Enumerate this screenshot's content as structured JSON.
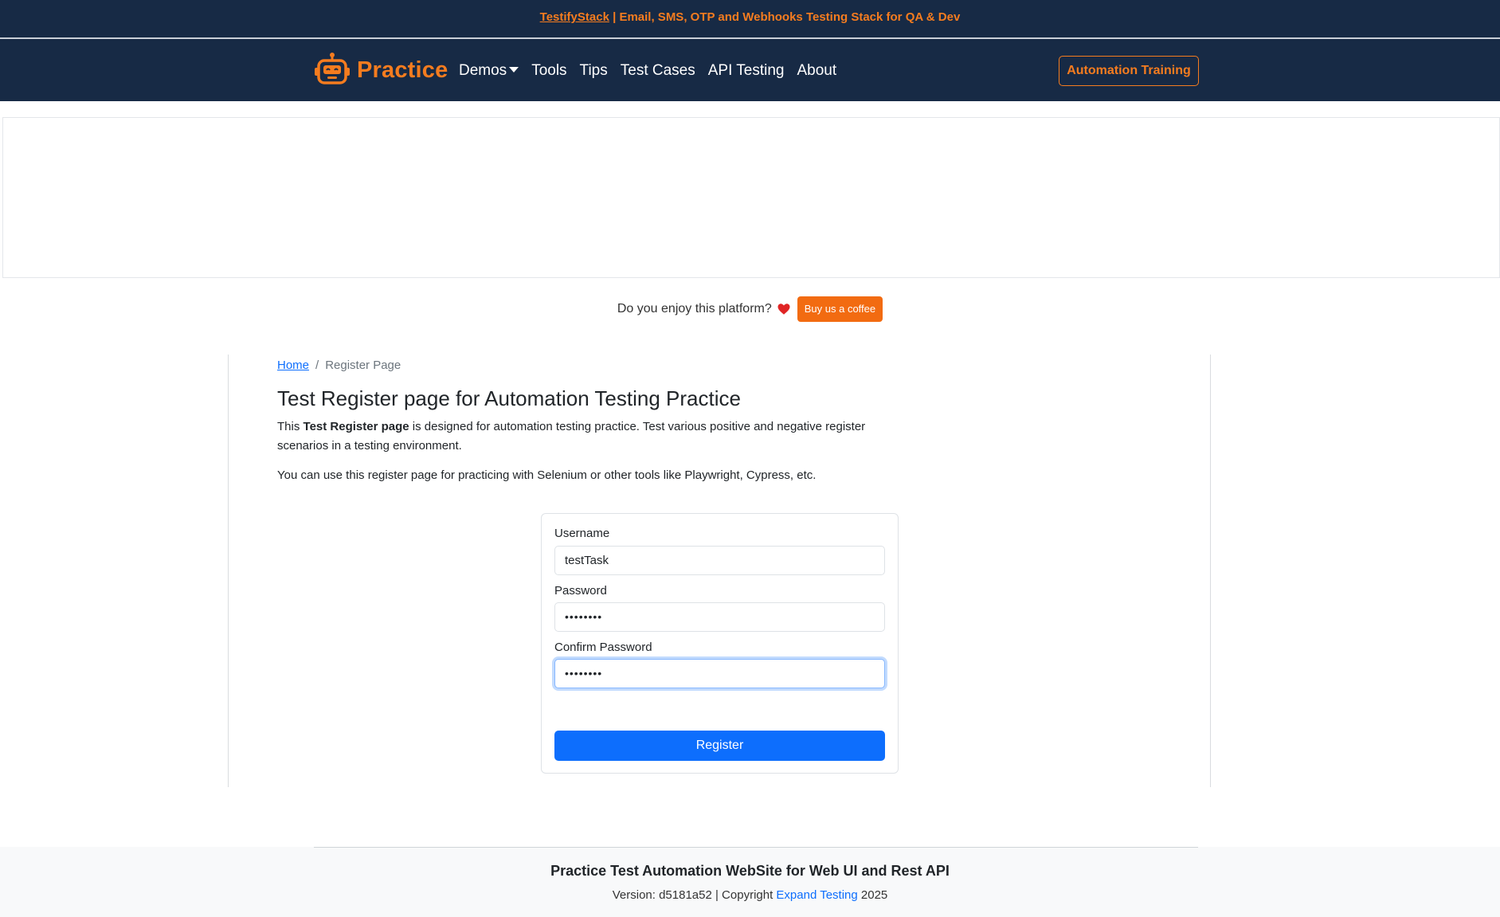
{
  "topbar": {
    "link_text": "TestifyStack",
    "text": " | Email, SMS, OTP and Webhooks Testing Stack for QA & Dev"
  },
  "navbar": {
    "brand": "Practice",
    "links": [
      "Demos",
      "Tools",
      "Tips",
      "Test Cases",
      "API Testing",
      "About"
    ],
    "cta": "Automation Training"
  },
  "support": {
    "text": "Do you enjoy this platform?",
    "button": "Buy us a coffee"
  },
  "breadcrumb": {
    "home": "Home",
    "separator": "/",
    "current": "Register Page"
  },
  "page": {
    "title": "Test Register page for Automation Testing Practice",
    "desc_prefix": "This ",
    "desc_bold": "Test Register page",
    "desc_suffix": " is designed for automation testing practice. Test various positive and negative register scenarios in a testing environment.",
    "desc2": "You can use this register page for practicing with Selenium or other tools like Playwright, Cypress, etc."
  },
  "form": {
    "username_label": "Username",
    "username_value": "testTask",
    "password_label": "Password",
    "password_value": "••••••••",
    "confirm_label": "Confirm Password",
    "confirm_value": "••••••••",
    "submit": "Register"
  },
  "footer": {
    "title": "Practice Test Automation WebSite for Web UI and Rest API",
    "copy_prefix": "Version: d5181a52 | Copyright ",
    "copy_link": "Expand Testing",
    "copy_suffix": " 2025"
  },
  "colors": {
    "navy": "#172a45",
    "accent_orange": "#f57c1f",
    "primary_blue": "#0d6efd"
  }
}
